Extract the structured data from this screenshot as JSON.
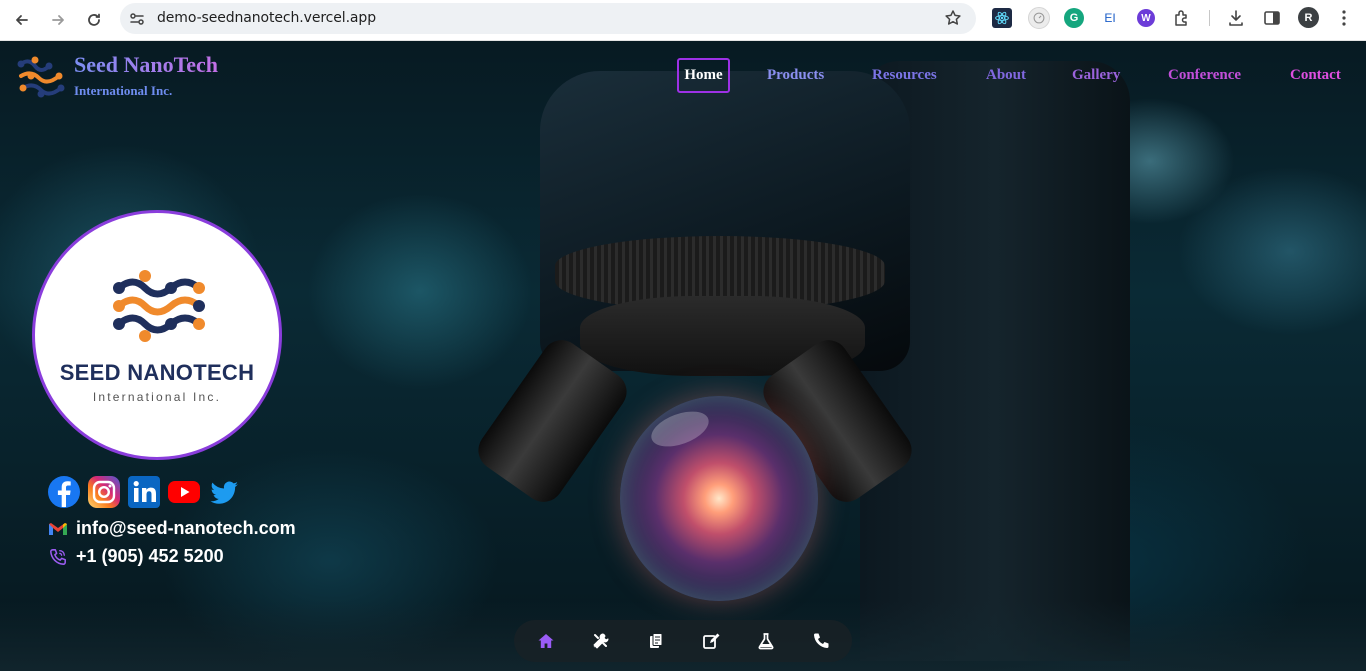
{
  "browser": {
    "url": "demo-seednanotech.vercel.app",
    "profile_initial": "R",
    "extensions": [
      "react-devtools-icon",
      "timer-extension-icon",
      "grammarly-icon",
      "eye-dropper-extension-icon",
      "wappalyzer-icon",
      "extensions-puzzle-icon"
    ]
  },
  "brand": {
    "name": "Seed NanoTech",
    "subtitle": "International Inc."
  },
  "nav": {
    "items": [
      {
        "label": "Home",
        "color": "#ffffff"
      },
      {
        "label": "Products",
        "color": "#8b8ff0"
      },
      {
        "label": "Resources",
        "color": "#7b74e6"
      },
      {
        "label": "About",
        "color": "#8168e0"
      },
      {
        "label": "Gallery",
        "color": "#9a63dc"
      },
      {
        "label": "Conference",
        "color": "#c24fd9"
      },
      {
        "label": "Contact",
        "color": "#de4fe0"
      }
    ]
  },
  "hero_logo": {
    "title": "SEED NANOTECH",
    "subtitle": "International Inc."
  },
  "social": [
    "facebook-icon",
    "instagram-icon",
    "linkedin-icon",
    "youtube-icon",
    "twitter-icon"
  ],
  "contact": {
    "email": "info@seed-nanotech.com",
    "phone": "+1 (905) 452 5200"
  },
  "dock": {
    "items": [
      "home-icon",
      "tools-icon",
      "documents-icon",
      "edit-icon",
      "flask-icon",
      "phone-icon"
    ],
    "active": "home-icon"
  },
  "colors": {
    "accent": "#9d31e6",
    "brand_blue": "#1f2f5c",
    "brand_orange": "#f08a2c"
  }
}
